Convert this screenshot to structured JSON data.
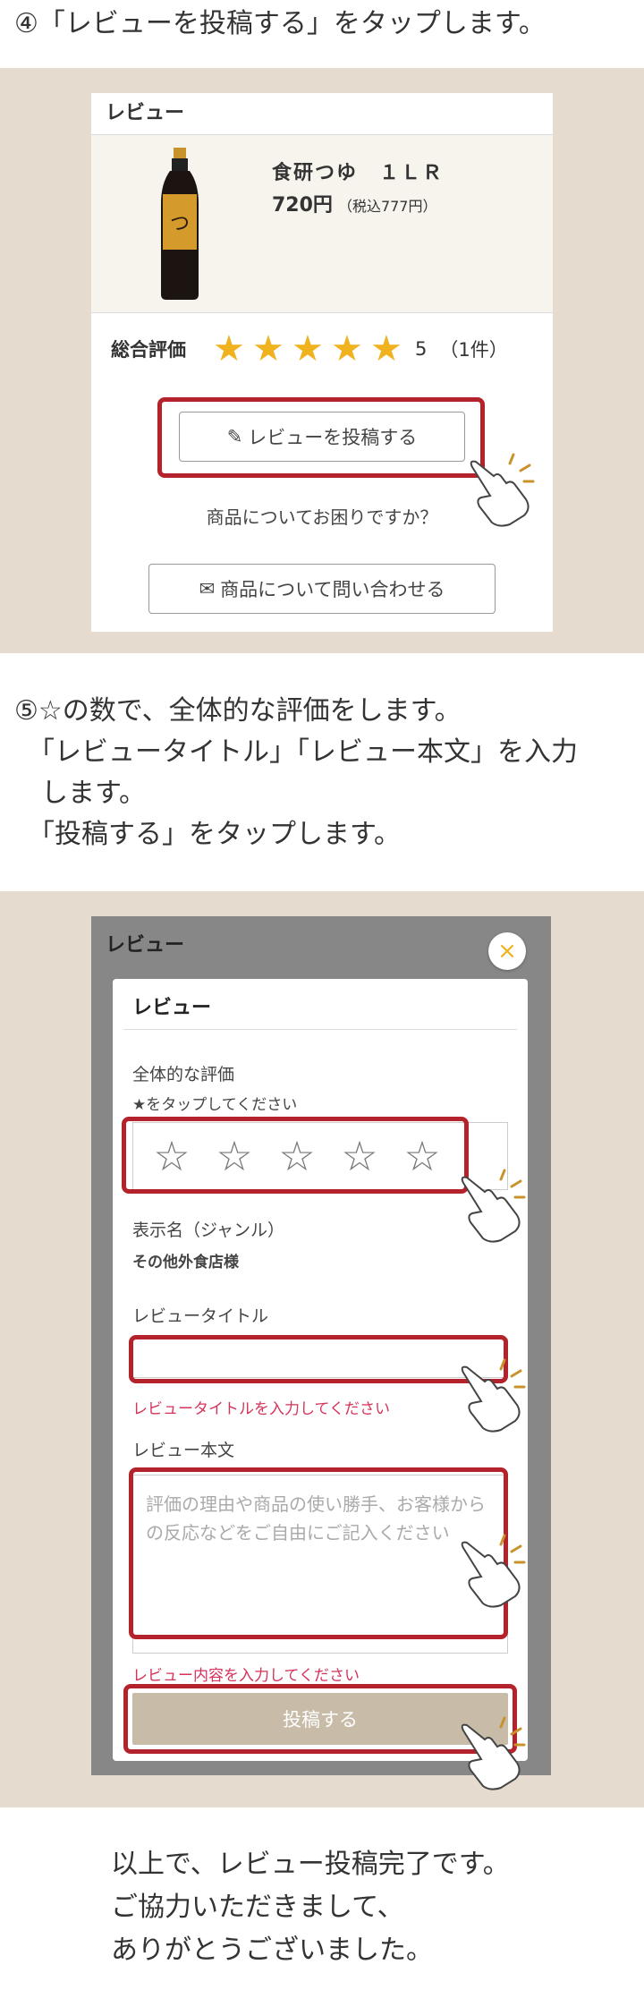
{
  "step4": {
    "text": "④「レビューを投稿する」をタップします。"
  },
  "card": {
    "header": "レビュー",
    "product_name": "食研つゆ　１ＬＲ",
    "price": "720円",
    "price_tax": "（税込777円）",
    "rating_label": "総合評価",
    "rating_value": "5",
    "rating_count": "（1件）",
    "stars": 5,
    "review_button": "レビューを投稿する",
    "question": "商品についてお困りですか？",
    "inquiry_button": "商品について問い合わせる"
  },
  "step5": {
    "text": "⑤☆の数で、全体的な評価をします。\n　「レビュータイトル」「レビュー本文」を入力\n　します。\n　「投稿する」をタップします。"
  },
  "modal": {
    "bg_header": "レビュー",
    "close": "×",
    "title": "レビュー",
    "overall_label": "全体的な評価",
    "tap_hint": "★をタップしてください",
    "display_name_label": "表示名（ジャンル）",
    "display_name_value": "その他外食店様",
    "review_title_label": "レビュータイトル",
    "review_title_error": "レビュータイトルを入力してください",
    "review_body_label": "レビュー本文",
    "review_body_placeholder": "評価の理由や商品の使い勝手、お客様からの反応などをご自由にご記入ください",
    "review_body_error": "レビュー内容を入力してください",
    "submit": "投稿する",
    "empty_stars": 5
  },
  "final": {
    "text": "以上で、レビュー投稿完了です。\nご協力いただきまして、\nありがとうございました。"
  },
  "colors": {
    "highlight": "#b4232c",
    "star": "#f0b21e",
    "panel": "#e5dbce",
    "error": "#d6335a",
    "submit": "#c8bba7"
  }
}
